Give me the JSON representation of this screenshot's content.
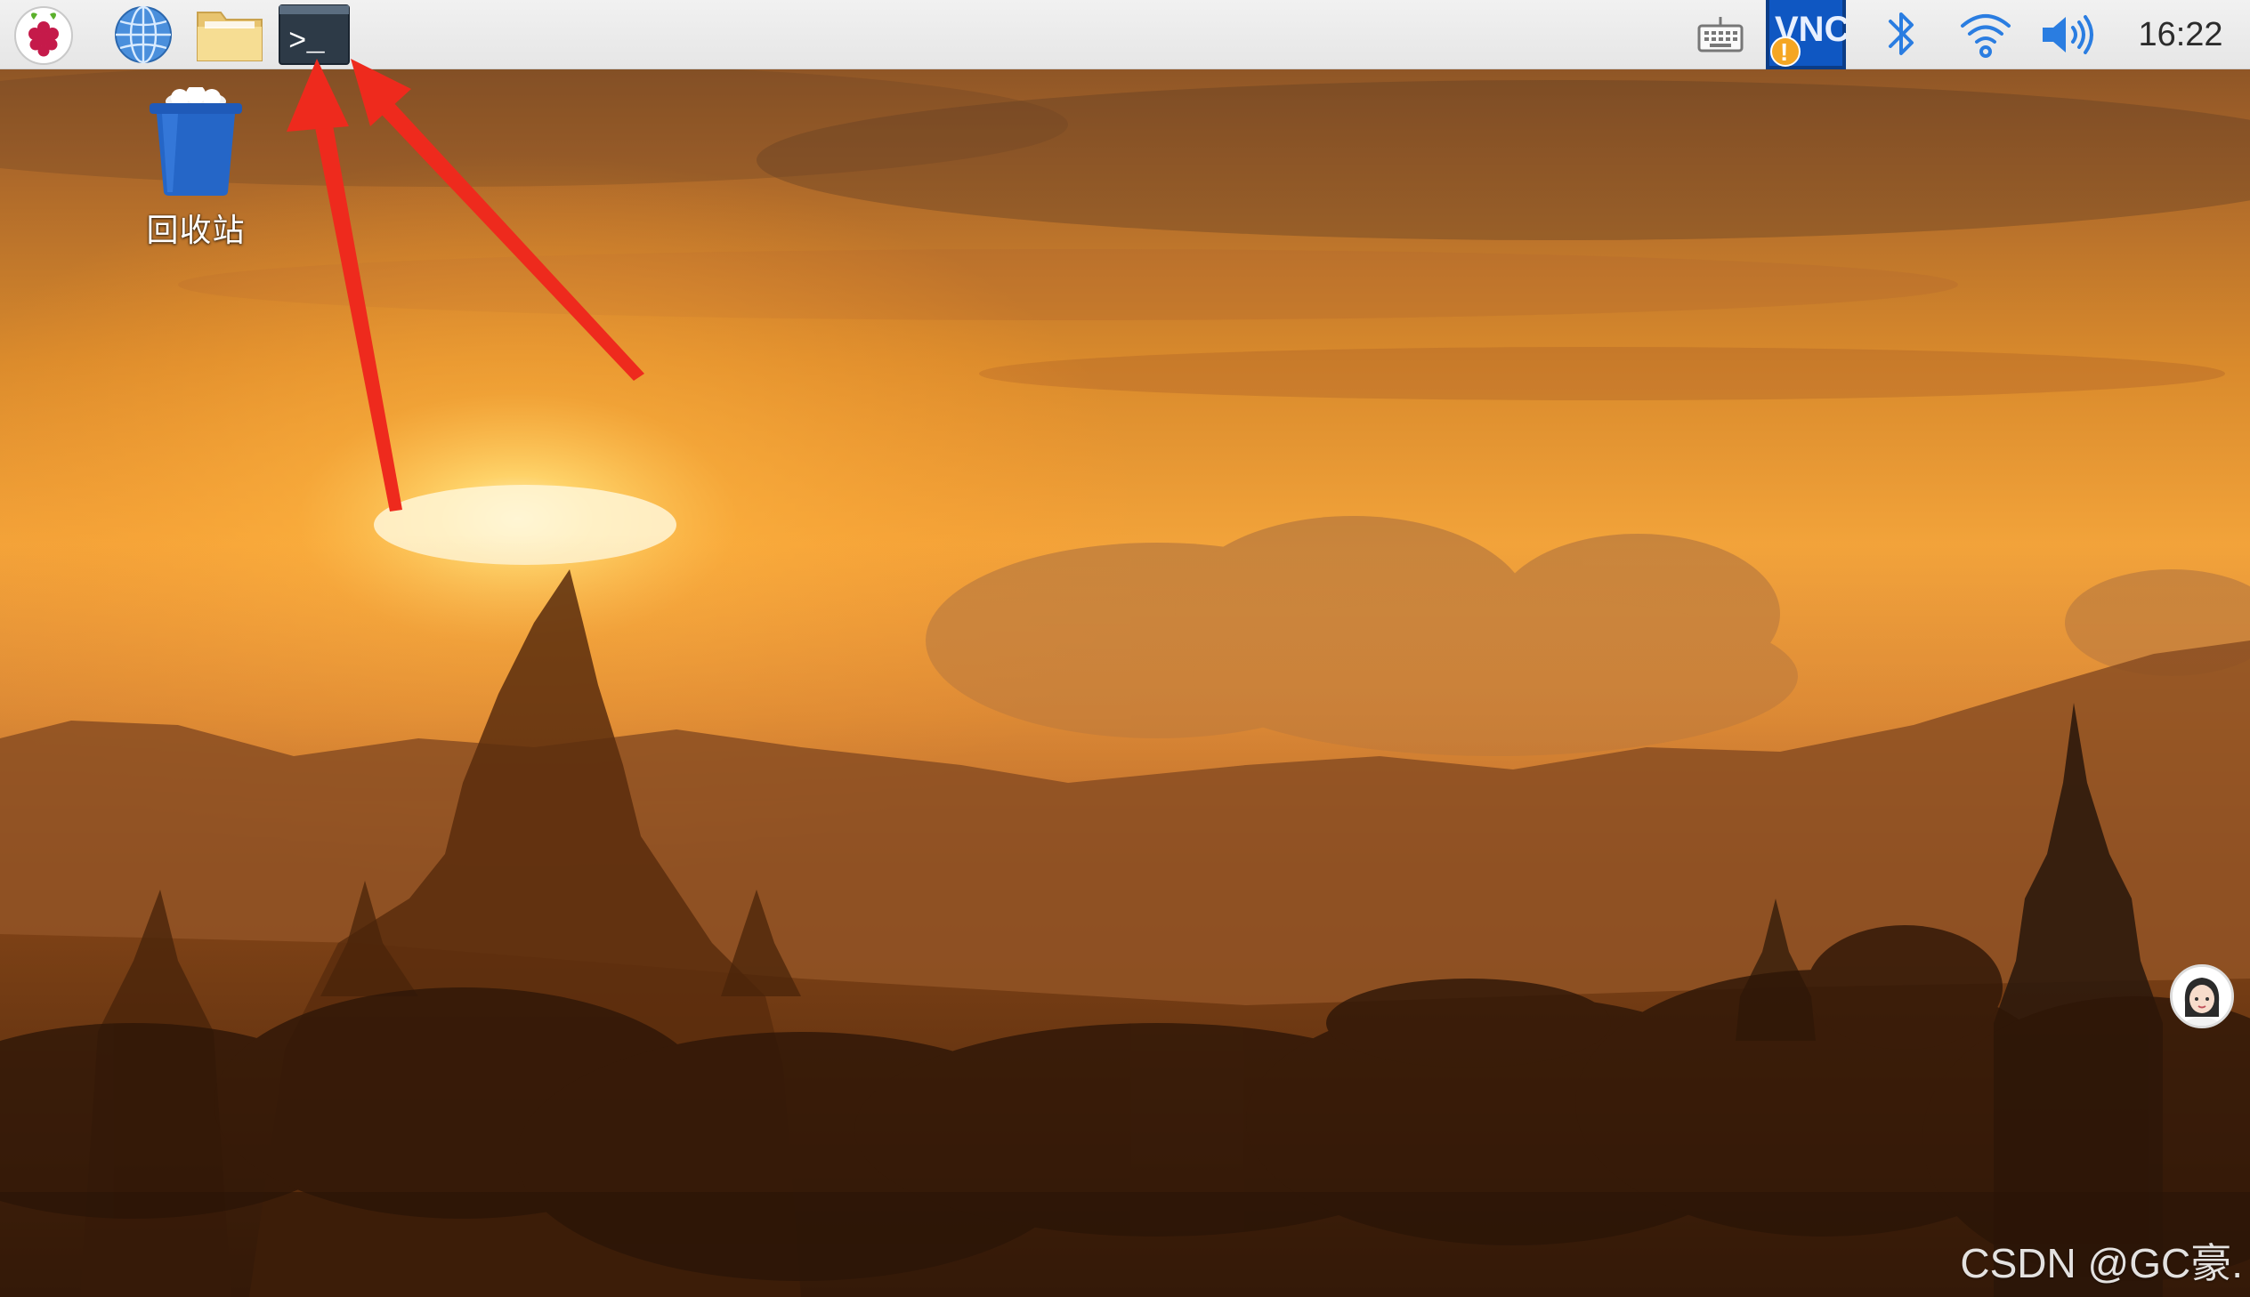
{
  "taskbar": {
    "launchers": [
      {
        "name": "Raspberry Pi menu",
        "icon": "raspberry-pi-logo-icon"
      },
      {
        "name": "Web browser",
        "icon": "globe-icon"
      },
      {
        "name": "File manager",
        "icon": "folder-icon"
      },
      {
        "name": "Terminal",
        "icon": "terminal-icon",
        "glyph": ">_"
      }
    ],
    "tray": {
      "keyboard_icon": "keyboard-icon",
      "vnc_icon": "vnc-server-icon",
      "vnc_text": "VNC",
      "vnc_warning_glyph": "!",
      "bluetooth_icon": "bluetooth-icon",
      "wifi_icon": "wifi-icon",
      "volume_icon": "volume-icon"
    },
    "clock": "16:22"
  },
  "desktop": {
    "icons": [
      {
        "label": "回收站",
        "icon": "trash-bin-icon"
      }
    ],
    "wallpaper": "sunset-over-temples",
    "annotation": "red-arrows-pointing-to-terminal-icon"
  },
  "overlay": {
    "avatar_icon": "user-avatar-icon",
    "watermark": "CSDN @GC豪."
  },
  "colors": {
    "taskbar_bg": "#ececec",
    "arrow_red": "#ee2a1d",
    "vnc_blue": "#1f6fd1",
    "tray_blue": "#2a7de1",
    "trash_blue": "#2566c7"
  }
}
